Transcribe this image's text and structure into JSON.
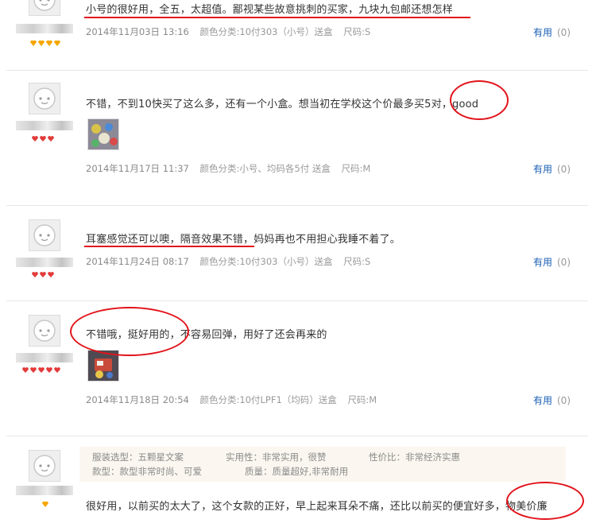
{
  "reviews": [
    {
      "text": "小号的很好用，全五，太超值。鄙视某些故意挑刺的买家，九块九包邮还想怎样",
      "date": "2014年11月03日 13:16",
      "variant": "颜色分类:10付303（小号）送盒",
      "size": "尺码:S",
      "helpful_label": "有用",
      "helpful_count": "(0)",
      "badge_icon": "diamond-icon",
      "badge_count": 4,
      "badge_color": "#f5a700"
    },
    {
      "text": "不错，不到10快买了这么多，还有一个小盒。想当初在学校这个价最多买5对，good",
      "date": "2014年11月17日 11:37",
      "variant": "颜色分类:小号、均码各5付 送盒",
      "size": "尺码:M",
      "helpful_label": "有用",
      "helpful_count": "(0)",
      "badge_icon": "heart-icon",
      "badge_count": 3,
      "badge_color": "#e23b3b"
    },
    {
      "text": "耳塞感觉还可以噢，隔音效果不错，妈妈再也不用担心我睡不着了。",
      "date": "2014年11月24日 08:17",
      "variant": "颜色分类:10付303（小号）送盒",
      "size": "尺码:S",
      "helpful_label": "有用",
      "helpful_count": "(0)",
      "badge_icon": "heart-icon",
      "badge_count": 3,
      "badge_color": "#e23b3b"
    },
    {
      "text": "不错哦，挺好用的，不容易回弹，用好了还会再来的",
      "date": "2014年11月18日 20:54",
      "variant": "颜色分类:10付LPF1（均码）送盒",
      "size": "尺码:M",
      "helpful_label": "有用",
      "helpful_count": "(0)",
      "badge_icon": "heart-icon",
      "badge_count": 5,
      "badge_color": "#e23b3b"
    },
    {
      "text": "很好用，以前买的太大了，这个女款的正好，早上起来耳朵不痛，还比以前买的便宜好多，物美价廉",
      "badge_icon": "diamond-icon",
      "badge_count": 1,
      "badge_color": "#f5a700",
      "tags": {
        "style": "服装选型：五颗星文案",
        "practical": "实用性：非常实用，很赞",
        "value": "性价比：非常经济实惠",
        "design": "款型：款型非常时尚、可爱",
        "quality": "质量：质量超好,非常耐用"
      }
    }
  ],
  "colors": {
    "accent_red": "#e2141b",
    "link_blue": "#1a5fb4"
  }
}
